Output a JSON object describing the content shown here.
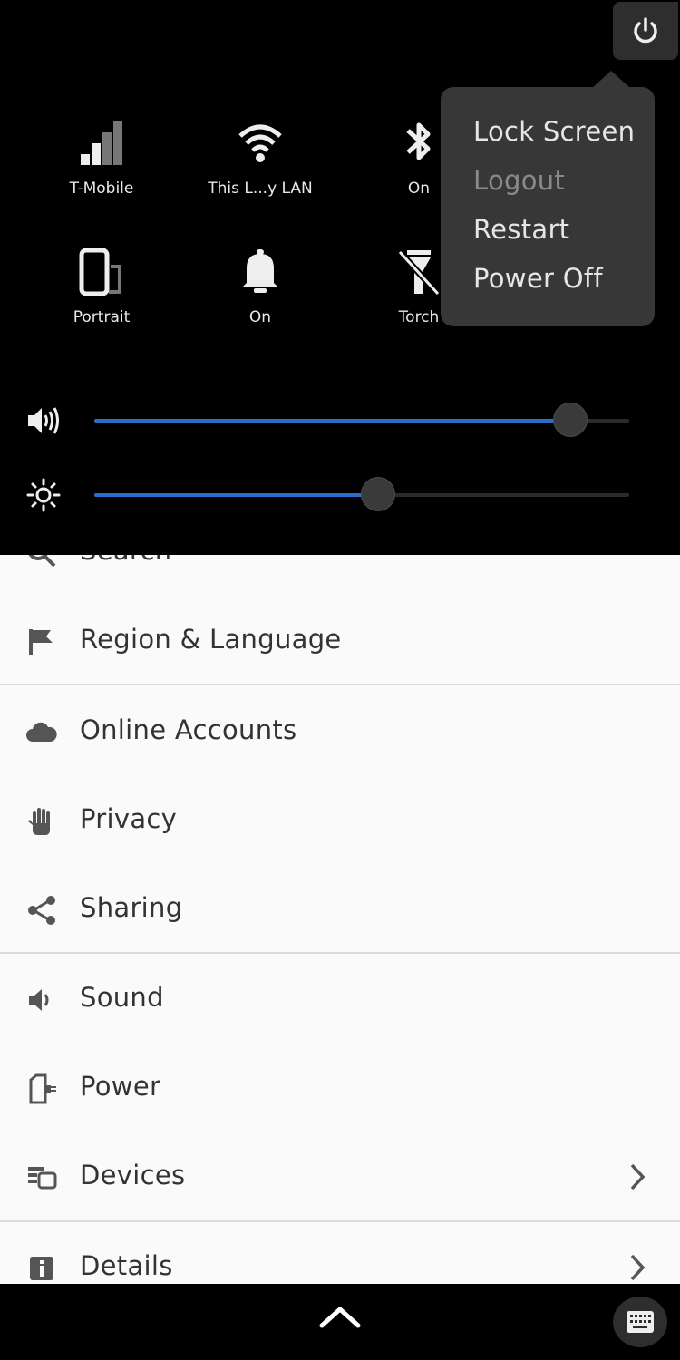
{
  "colors": {
    "accent": "#2a6dc8",
    "panel_bg": "#000000",
    "menu_bg": "#373737",
    "list_bg": "#fafafa"
  },
  "quick_settings": {
    "tiles": [
      {
        "icon": "cellular-signal-icon",
        "label": "T-Mobile"
      },
      {
        "icon": "wifi-icon",
        "label": "This L...y LAN"
      },
      {
        "icon": "bluetooth-icon",
        "label": "On"
      },
      {
        "icon": "rotation-icon",
        "label": "Portrait"
      },
      {
        "icon": "bell-icon",
        "label": "On"
      },
      {
        "icon": "torch-icon",
        "label": "Torch"
      }
    ]
  },
  "sliders": {
    "volume": {
      "icon": "speaker-icon",
      "level": 0.89
    },
    "brightness": {
      "icon": "brightness-icon",
      "level": 0.53
    }
  },
  "power_menu": {
    "items": [
      {
        "label": "Lock Screen",
        "enabled": true
      },
      {
        "label": "Logout",
        "enabled": false
      },
      {
        "label": "Restart",
        "enabled": true
      },
      {
        "label": "Power Off",
        "enabled": true
      }
    ]
  },
  "settings_list": {
    "items": [
      {
        "icon": "search-icon",
        "label": "Search"
      },
      {
        "icon": "flag-icon",
        "label": "Region & Language"
      },
      {
        "icon": "cloud-icon",
        "label": "Online Accounts"
      },
      {
        "icon": "hand-icon",
        "label": "Privacy"
      },
      {
        "icon": "share-icon",
        "label": "Sharing"
      },
      {
        "icon": "speaker-icon",
        "label": "Sound"
      },
      {
        "icon": "power-plug-icon",
        "label": "Power"
      },
      {
        "icon": "devices-icon",
        "label": "Devices",
        "has_chevron": true
      },
      {
        "icon": "info-icon",
        "label": "Details",
        "has_chevron": true
      }
    ]
  },
  "bottom_bar": {
    "up_icon": "chevron-up-icon",
    "keyboard_icon": "keyboard-icon"
  }
}
